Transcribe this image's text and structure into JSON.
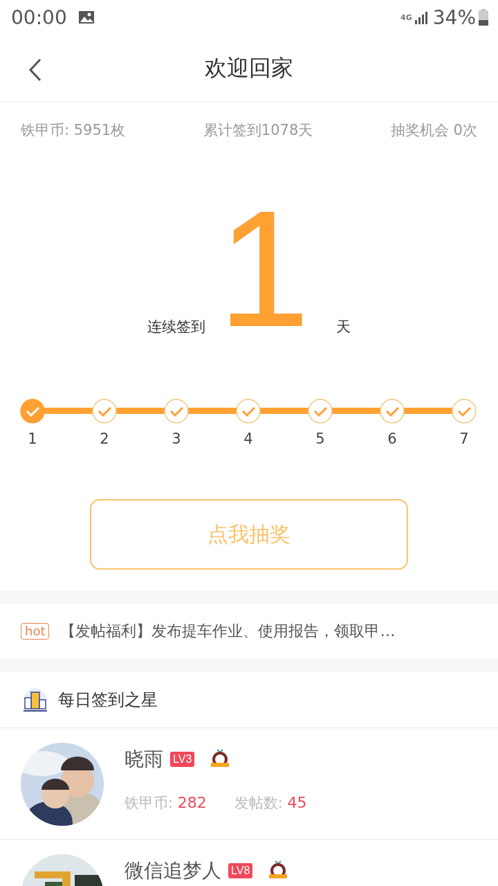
{
  "status_bar": {
    "time": "00:00",
    "network": "4G",
    "battery": "34%"
  },
  "header": {
    "title": "欢迎回家"
  },
  "stats": [
    "铁甲币: 5951枚",
    "累计签到1078天",
    "抽奖机会 0次"
  ],
  "streak": {
    "prefix": "连续签到",
    "count": "1",
    "suffix": "天"
  },
  "days": [
    {
      "label": "1",
      "signed": true
    },
    {
      "label": "2",
      "signed": false
    },
    {
      "label": "3",
      "signed": false
    },
    {
      "label": "4",
      "signed": false
    },
    {
      "label": "5",
      "signed": false
    },
    {
      "label": "6",
      "signed": false
    },
    {
      "label": "7",
      "signed": false
    }
  ],
  "lottery_button": "点我抽奖",
  "notice": {
    "tag": "hot",
    "text": "【发帖福利】发布提车作业、使用报告，领取甲…"
  },
  "star_section": {
    "title": "每日签到之星"
  },
  "users": [
    {
      "name": "晓雨",
      "level": "LV3",
      "stats": [
        {
          "label": "铁甲币: ",
          "value": "282"
        },
        {
          "label": "发帖数: ",
          "value": "45"
        }
      ]
    },
    {
      "name": "微信追梦人",
      "level": "LV8"
    }
  ]
}
